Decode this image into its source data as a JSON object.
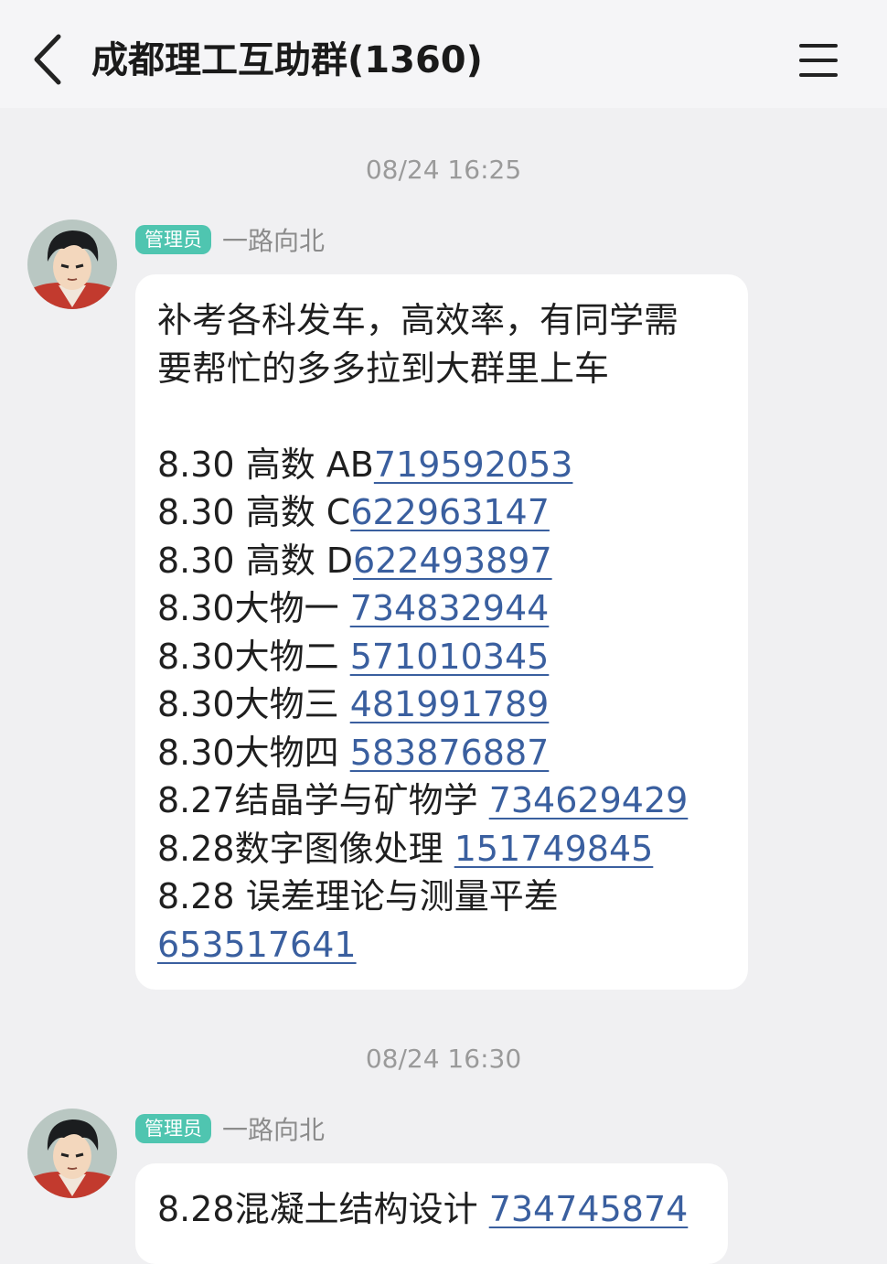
{
  "header": {
    "title": "成都理工互助群(1360)",
    "back_icon": "chevron-left-icon",
    "menu_icon": "hamburger-menu-icon"
  },
  "messages": [
    {
      "timestamp": "08/24 16:25",
      "role_badge": "管理员",
      "sender": "一路向北",
      "intro_lines": [
        "补考各科发车，高效率，有同学需",
        "要帮忙的多多拉到大群里上车"
      ],
      "entries": [
        {
          "text": "8.30 高数 AB",
          "link": "719592053"
        },
        {
          "text": "8.30 高数 C",
          "link": "622963147"
        },
        {
          "text": "8.30 高数 D",
          "link": "622493897"
        },
        {
          "text": "8.30大物一 ",
          "link": "734832944"
        },
        {
          "text": "8.30大物二 ",
          "link": "571010345"
        },
        {
          "text": "8.30大物三 ",
          "link": "481991789"
        },
        {
          "text": "8.30大物四 ",
          "link": "583876887"
        },
        {
          "text": "8.27结晶学与矿物学 ",
          "link": "734629429"
        },
        {
          "text": "8.28数字图像处理 ",
          "link": "151749845"
        },
        {
          "text": "8.28 误差理论与测量平差",
          "link": ""
        },
        {
          "text": "",
          "link": "653517641"
        }
      ]
    },
    {
      "timestamp": "08/24 16:30",
      "role_badge": "管理员",
      "sender": "一路向北",
      "entries": [
        {
          "text": "8.28混凝土结构设计 ",
          "link": "734745874"
        }
      ]
    }
  ],
  "colors": {
    "background": "#f0f0f2",
    "bubble": "#ffffff",
    "link": "#3a5f9f",
    "badge": "#4fc5b0"
  }
}
